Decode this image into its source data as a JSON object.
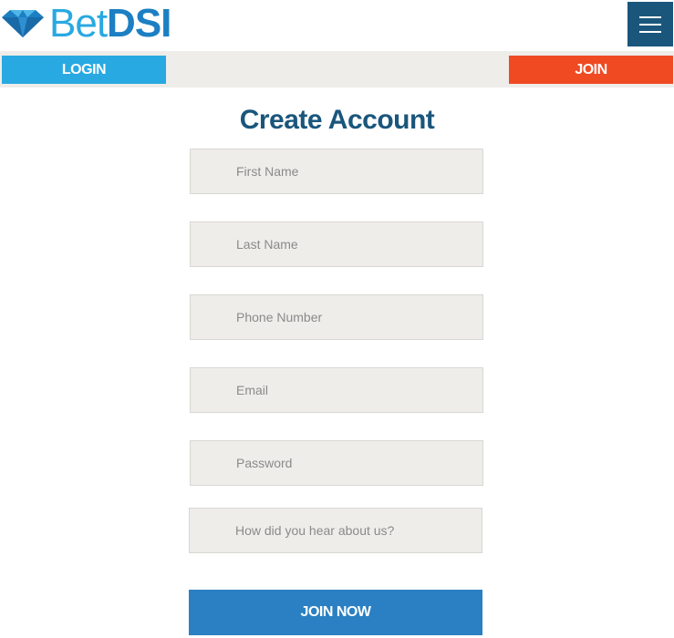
{
  "brand": {
    "name_part1": "Bet",
    "name_part2": "DSI",
    "colors": {
      "bet": "#29a9e1",
      "dsi": "#1d7fc3",
      "gem": "#1d7fc3"
    }
  },
  "header": {
    "menu_icon": "hamburger-menu-icon",
    "menu_color": "#1a567c"
  },
  "nav": {
    "login_label": "LOGIN",
    "join_label": "JOIN",
    "login_color": "#29a9e1",
    "join_color": "#f04a23"
  },
  "form": {
    "title": "Create Account",
    "fields": [
      {
        "name": "first-name",
        "placeholder": "First Name",
        "value": ""
      },
      {
        "name": "last-name",
        "placeholder": "Last Name",
        "value": ""
      },
      {
        "name": "phone-number",
        "placeholder": "Phone Number",
        "value": ""
      },
      {
        "name": "email",
        "placeholder": "Email",
        "value": ""
      },
      {
        "name": "password",
        "placeholder": "Password",
        "value": ""
      },
      {
        "name": "referral-source",
        "placeholder": "How did you hear about us?",
        "value": ""
      }
    ],
    "submit_label": "JOIN NOW",
    "submit_color": "#2a80c2"
  }
}
